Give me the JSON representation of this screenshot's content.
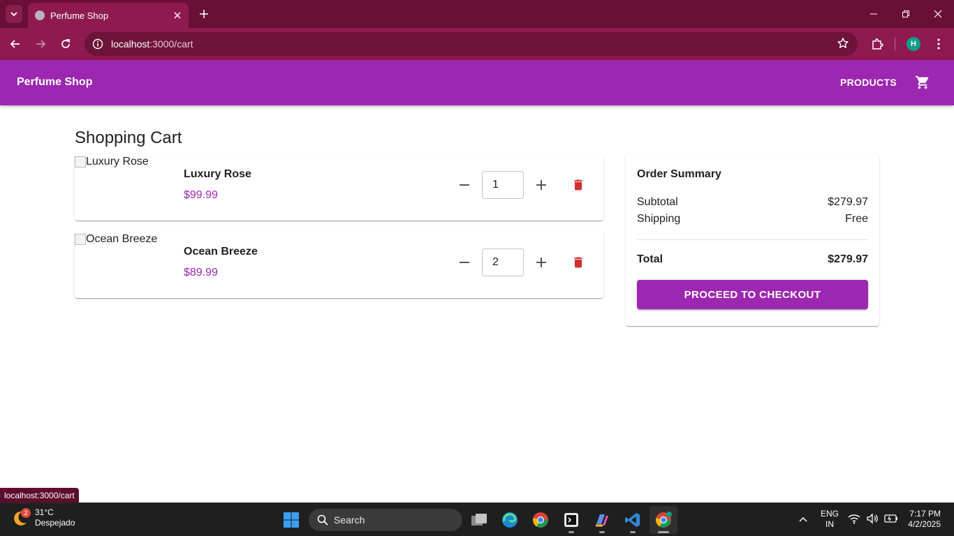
{
  "browser": {
    "tab_title": "Perfume Shop",
    "url_host": "localhost",
    "url_path": ":3000/cart",
    "profile_initial": "H",
    "status_url": "localhost:3000/cart"
  },
  "appbar": {
    "brand": "Perfume Shop",
    "products_label": "PRODUCTS"
  },
  "page": {
    "title": "Shopping Cart"
  },
  "cart": {
    "items": [
      {
        "image_alt": "Luxury Rose",
        "name": "Luxury Rose",
        "price": "$99.99",
        "quantity": "1"
      },
      {
        "image_alt": "Ocean Breeze",
        "name": "Ocean Breeze",
        "price": "$89.99",
        "quantity": "2"
      }
    ]
  },
  "summary": {
    "title": "Order Summary",
    "subtotal_label": "Subtotal",
    "subtotal_value": "$279.97",
    "shipping_label": "Shipping",
    "shipping_value": "Free",
    "total_label": "Total",
    "total_value": "$279.97",
    "checkout_label": "PROCEED TO CHECKOUT"
  },
  "taskbar": {
    "weather_temp": "31°C",
    "weather_desc": "Despejado",
    "weather_badge": "2",
    "search_label": "Search",
    "lang_line1": "ENG",
    "lang_line2": "IN",
    "time": "7:17 PM",
    "date": "4/2/2025"
  },
  "colors": {
    "primary": "#9c27b0",
    "browser_frame": "#8e1a4f",
    "delete": "#d32f2f"
  }
}
